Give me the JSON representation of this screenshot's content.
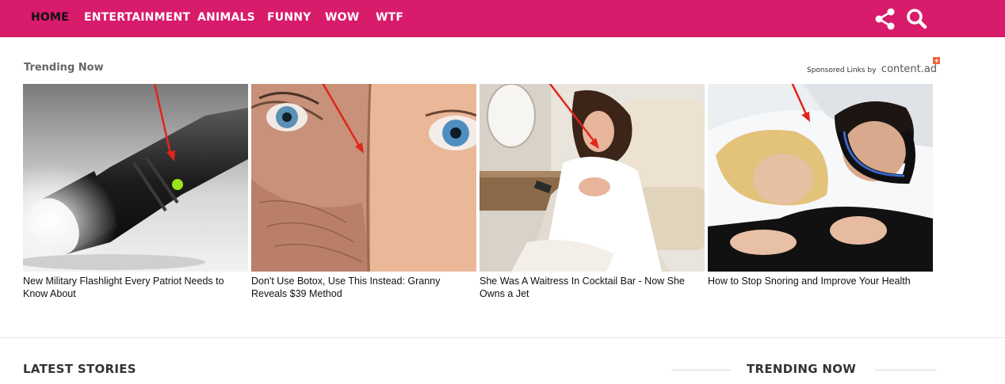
{
  "theme": {
    "nav_bg": "#d81b6b",
    "arrow": "#e1251b"
  },
  "nav": {
    "items": [
      {
        "label": "HOME",
        "active": true
      },
      {
        "label": "ENTERTAINMENT"
      },
      {
        "label": "ANIMALS"
      },
      {
        "label": "FUNNY"
      },
      {
        "label": "WOW"
      },
      {
        "label": "WTF"
      }
    ],
    "icons": [
      "share-icon",
      "search-icon"
    ]
  },
  "trending_widget": {
    "label": "Trending Now",
    "sponsored_text": "Sponsored Links by",
    "brand": "content.ad",
    "cards": [
      {
        "title": "New Military Flashlight Every Patriot Needs to Know About",
        "image": "tactical flashlight"
      },
      {
        "title": "Don't Use Botox, Use This Instead: Granny Reveals $39 Method",
        "image": "aged and young faces"
      },
      {
        "title": "She Was A Waitress In Cocktail Bar - Now She Owns a Jet",
        "image": "woman in private jet"
      },
      {
        "title": "How to Stop Snoring and Improve Your Health",
        "image": "couple sleeping"
      }
    ]
  },
  "sections": {
    "latest": "LATEST STORIES",
    "trending": "TRENDING NOW"
  }
}
